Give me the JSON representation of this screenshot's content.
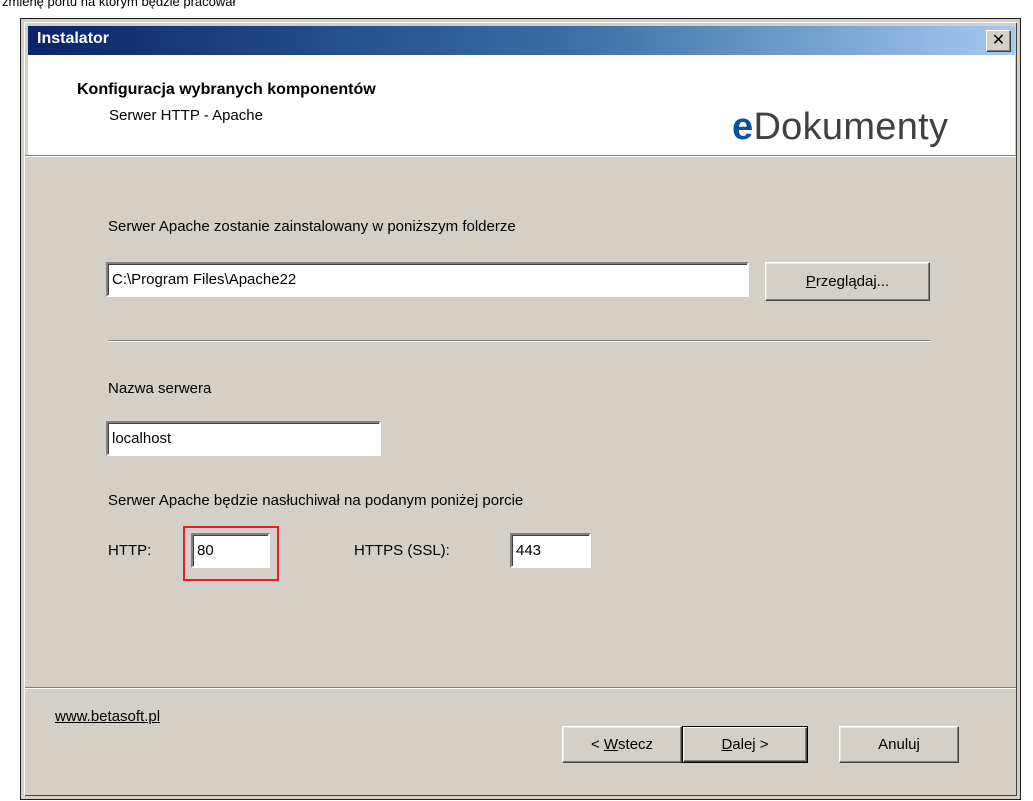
{
  "caption": "zmienę portu na którym będzie pracował",
  "window": {
    "title": "Instalator",
    "close_glyph": "✕"
  },
  "header": {
    "title": "Konfiguracja wybranych komponentów",
    "subtitle": "Serwer HTTP - Apache",
    "logo": {
      "prefix": "e",
      "rest": "Dokumenty"
    }
  },
  "install_folder": {
    "label": "Serwer Apache zostanie zainstalowany w poniższym folderze",
    "value": "C:\\Program Files\\Apache22",
    "browse_button": {
      "underlined": "P",
      "rest": "rzeglądaj..."
    }
  },
  "server_name": {
    "label": "Nazwa serwera",
    "value": "localhost"
  },
  "ports": {
    "label": "Serwer Apache będzie nasłuchiwał na podanym poniżej porcie",
    "http_label": "HTTP:",
    "http_value": "80",
    "https_label": "HTTPS (SSL):",
    "https_value": "443"
  },
  "footer": {
    "link": "www.betasoft.pl",
    "back_button": {
      "prefix": "< ",
      "underlined": "W",
      "rest": "stecz"
    },
    "next_button": {
      "underlined": "D",
      "rest": "alej >"
    },
    "cancel_button": "Anuluj"
  },
  "colors": {
    "highlight": "#e02020",
    "title_gradient_start": "#0a246a",
    "logo_accent": "#0b4fa0"
  }
}
